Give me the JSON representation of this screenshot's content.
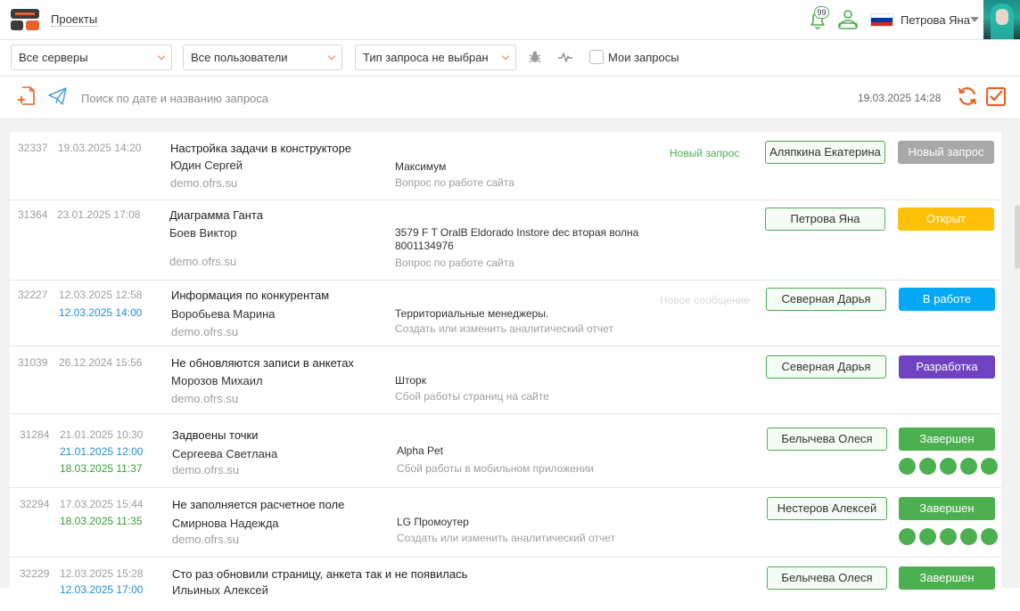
{
  "header": {
    "projects_label": "Проекты",
    "notification_count": "99",
    "user_name": "Петрова Яна"
  },
  "filters": {
    "servers": "Все серверы",
    "users": "Все пользователи",
    "request_type": "Тип запроса не выбран",
    "my_requests": "Мои запросы"
  },
  "search": {
    "placeholder": "Поиск по дате и названию запроса",
    "datetime": "19.03.2025 14:28"
  },
  "colors": {
    "accent": "#e8622a",
    "status_new": "#a8a8a8",
    "status_open": "#ffc107",
    "status_in_work": "#03a9f4",
    "status_dev": "#6f42c1",
    "status_done": "#4caf50",
    "green": "#4caf50"
  },
  "requests": [
    {
      "id": "32337",
      "date1": "19.03.2025 14:20",
      "title": "Настройка задачи в конструкторе",
      "person": "Юдин Сергей",
      "site": "demo.ofrs.su",
      "project": "Максимум",
      "category": "Вопрос по работе сайта",
      "note": "Новый запрос",
      "assignee": "Аляпкина Екатерина",
      "status": "Новый запрос"
    },
    {
      "id": "31364",
      "date1": "23.01.2025 17:08",
      "title": "Диаграмма Ганта",
      "person": "Боев Виктор",
      "site": "demo.ofrs.su",
      "project": "3579 F T OralB Eldorado Instore dec вторая волна 8001134976",
      "category": "Вопрос по работе сайта",
      "assignee": "Петрова Яна",
      "status": "Открыт"
    },
    {
      "id": "32227",
      "date1": "12.03.2025 12:58",
      "date2": "12.03.2025 14:00",
      "title": "Информация по конкурентам",
      "person": "Воробьева Марина",
      "site": "demo.ofrs.su",
      "project": "Территориальные менеджеры.",
      "category": "Создать или изменить аналитический отчет",
      "note": "Новое сообщение",
      "assignee": "Северная Дарья",
      "status": "В работе"
    },
    {
      "id": "31039",
      "date1": "26.12.2024 15:56",
      "title": "Не обновляются записи в анкетах",
      "person": "Морозов Михаил",
      "site": "demo.ofrs.su",
      "project": "Шторк",
      "category": "Сбой работы страниц на сайте",
      "assignee": "Северная Дарья",
      "status": "Разработка"
    },
    {
      "id": "31284",
      "date1": "21.01.2025 10:30",
      "date2": "21.01.2025 12:00",
      "date3": "18.03.2025 11:37",
      "title": "Задвоены точки",
      "person": "Сергеева Светлана",
      "site": "demo.ofrs.su",
      "project": "Alpha Pet",
      "category": "Сбой работы в мобильном приложении",
      "assignee": "Белычева Олеся",
      "status": "Завершен",
      "rating": 5
    },
    {
      "id": "32294",
      "date1": "17.03.2025 15:44",
      "date3": "18.03.2025 11:35",
      "title": "Не заполняется расчетное поле",
      "person": "Смирнова Надежда",
      "site": "demo.ofrs.su",
      "project": "LG Промоутер",
      "category": "Создать или изменить аналитический отчет",
      "assignee": "Нестеров Алексей",
      "status": "Завершен",
      "rating": 5
    },
    {
      "id": "32229",
      "date1": "12.03.2025 15:28",
      "date2": "12.03.2025 17:00",
      "title": "Сто раз обновили страницу, анкета так и не появилась",
      "person": "Ильиных Алексей",
      "assignee": "Белычева Олеся",
      "status": "Завершен"
    }
  ]
}
